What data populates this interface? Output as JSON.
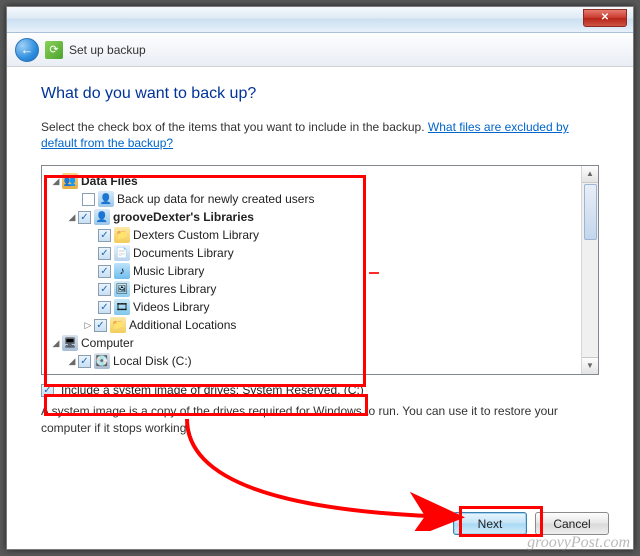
{
  "window": {
    "title": "Set up backup"
  },
  "heading": "What do you want to back up?",
  "subtext_lead": "Select the check box of the items that you want to include in the backup. ",
  "subtext_link": "What files are excluded by default from the backup?",
  "tree": {
    "data_files": "Data Files",
    "new_users": "Back up data for newly created users",
    "user_lib": "grooveDexter's Libraries",
    "custom_lib": "Dexters Custom Library",
    "documents": "Documents Library",
    "music": "Music Library",
    "pictures": "Pictures Library",
    "videos": "Videos Library",
    "additional": "Additional Locations",
    "computer": "Computer",
    "local_disk": "Local Disk (C:)"
  },
  "system_image": {
    "label": "Include a system image of drives: System Reserved, (C:)",
    "desc": "A system image is a copy of the drives required for Windows to run. You can use it to restore your computer if it stops working."
  },
  "buttons": {
    "next": "Next",
    "cancel": "Cancel"
  },
  "watermark": "groovyPost.com"
}
